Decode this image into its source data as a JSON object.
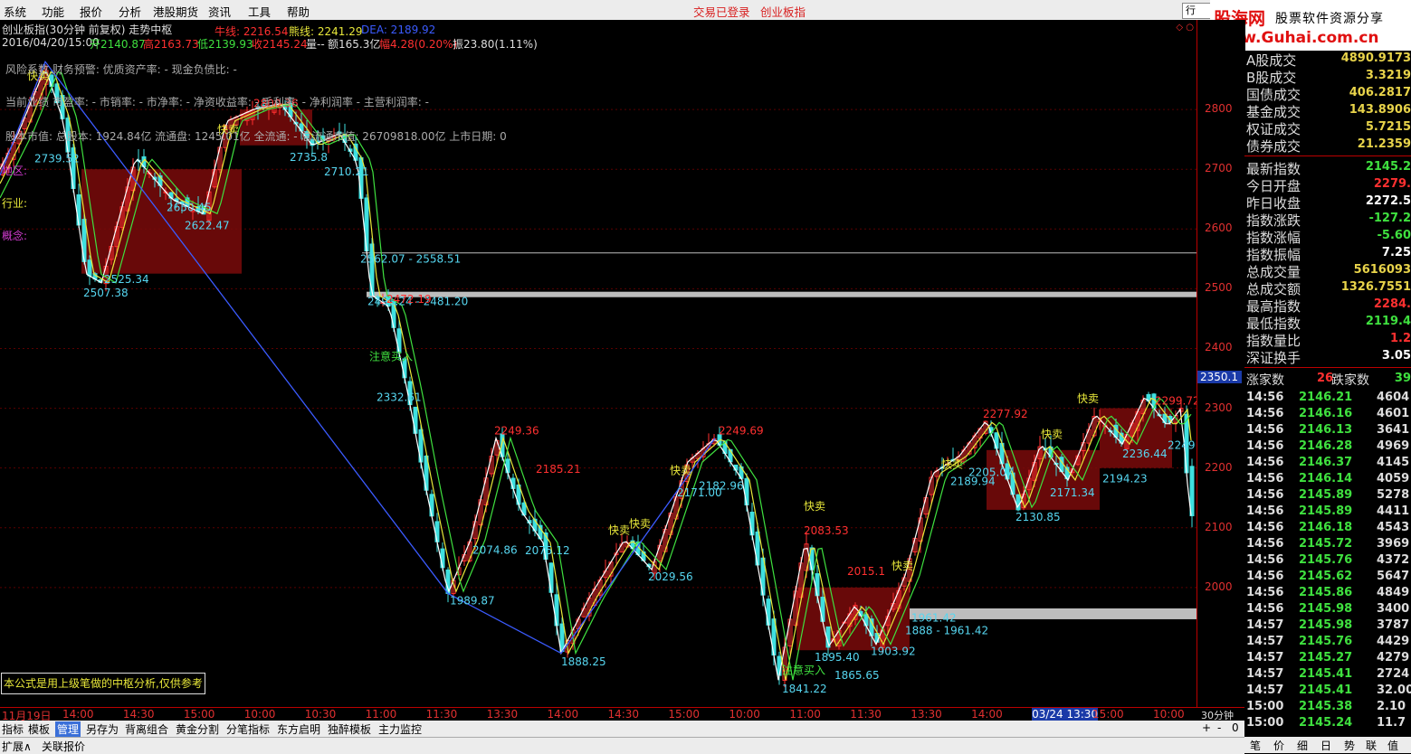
{
  "menu": {
    "items": [
      "系统",
      "功能",
      "报价",
      "分析",
      "港股期货",
      "资讯",
      "工具",
      "帮助"
    ],
    "center_links": [
      "交易已登录",
      "创业板指"
    ],
    "row_selector": "行"
  },
  "logo": {
    "name": "股海网",
    "slogan": "股票软件资源分享",
    "url": "www.Guhai.com.cn"
  },
  "chart_header": {
    "title": "创业板指(30分钟 前复权) 走势中枢",
    "niu_label": "牛线: 2216.54",
    "xiong_label": "熊线: 2241.29",
    "dea_label": "DEA: 2189.92",
    "bar_info": {
      "date": "2016/04/20/15:00",
      "open": "开2140.87",
      "high": "高2163.73",
      "low": "低2139.93",
      "close": "收2145.24",
      "vol": "量--",
      "amount": "额165.3亿",
      "change": "幅4.28(0.20%)",
      "amplitude": "振23.80(1.11%)"
    },
    "risk_line": "风险系数 财务预警: 优质资产率: - 现金负债比: -",
    "perf_line": "当前业绩 市盈率: - 市销率: - 市净率: - 净资收益率: - 毛利率: - 净利润率 - 主营利润率: -",
    "shares_line": "股本市值: 总股本: 1924.84亿 流通盘: 1245.01亿 全流通: - 总流通市值: 26709818.00亿 上市日期: 0",
    "region_label": "地区:",
    "industry_label": "行业:",
    "concept_label": "概念:"
  },
  "footnote": "本公式是用上级笔做的中枢分析,仅供参考",
  "chart_data": {
    "type": "candlestick",
    "title": "创业板指(30分钟 前复权) 走势中枢",
    "ylim": [
      1800,
      2950
    ],
    "y_ticks": [
      2000,
      2100,
      2200,
      2300,
      2400,
      2500,
      2600,
      2700,
      2800
    ],
    "current_price_label": "2350.1",
    "x_ticks": [
      "11月19日",
      "14:00",
      "14:30",
      "15:00",
      "10:00",
      "10:30",
      "11:00",
      "11:30",
      "13:30",
      "14:00",
      "14:30",
      "15:00",
      "10:00",
      "11:00",
      "11:30",
      "13:30",
      "14:00",
      "03/24 13:30",
      "15:00",
      "10:00"
    ],
    "period_label": "30分钟",
    "price_annotations": [
      "2739.52",
      "2525.34",
      "2507.38",
      "2650.45",
      "2622.47",
      "2735.8",
      "2710.21",
      "2800.36",
      "2562.07 - 2558.51",
      "2491.24 - 2481.20",
      "2472.19",
      "2332.61",
      "2249.36",
      "2185.21",
      "2074.86",
      "2075.12",
      "1989.87",
      "1888.25",
      "2029.56",
      "2249.69",
      "2171.00",
      "2182.96",
      "2083.53",
      "2015.1",
      "1895.40",
      "1865.65",
      "1903.92",
      "1841.22",
      "1961.42",
      "1888 - 1961.42",
      "2277.92",
      "2205.07",
      "2189.94",
      "2130.85",
      "2171.34",
      "2194.23",
      "2236.44",
      "2299.72",
      "2249"
    ],
    "signals": [
      "快卖",
      "注意买入"
    ],
    "pivot_zones": [
      {
        "from": "2525.34",
        "to": "2700"
      },
      {
        "from": "2740",
        "to": "2800"
      },
      {
        "from": "2130",
        "to": "2230"
      },
      {
        "from": "1895",
        "to": "2000"
      },
      {
        "from": "2200",
        "to": "2300"
      }
    ],
    "series": [
      {
        "name": "牛线"
      },
      {
        "name": "熊线"
      },
      {
        "name": "DEA"
      }
    ]
  },
  "tabs": [
    "指标",
    "模板",
    "管理",
    "另存为",
    "背离组合",
    "黄金分割",
    "分笔指标",
    "东方启明",
    "独醉模板",
    "主力监控"
  ],
  "status": [
    "扩展∧",
    "关联报价"
  ],
  "nav_controls": [
    "+",
    "-",
    "0"
  ],
  "market_stats": [
    {
      "label": "A股成交",
      "value": "4890.9173",
      "color": "#e8d34a"
    },
    {
      "label": "B股成交",
      "value": "3.3219",
      "color": "#e8d34a"
    },
    {
      "label": "国债成交",
      "value": "406.2817",
      "color": "#e8d34a"
    },
    {
      "label": "基金成交",
      "value": "143.8906",
      "color": "#e8d34a"
    },
    {
      "label": "权证成交",
      "value": "5.7215",
      "color": "#e8d34a"
    },
    {
      "label": "债券成交",
      "value": "21.2359",
      "color": "#e8d34a"
    }
  ],
  "index_stats": [
    {
      "label": "最新指数",
      "value": "2145.2",
      "color": "#3fe03f"
    },
    {
      "label": "今日开盘",
      "value": "2279.",
      "color": "#ff3030"
    },
    {
      "label": "昨日收盘",
      "value": "2272.5",
      "color": "#ffffff"
    },
    {
      "label": "指数涨跌",
      "value": "-127.2",
      "color": "#3fe03f"
    },
    {
      "label": "指数涨幅",
      "value": "-5.60",
      "color": "#3fe03f"
    },
    {
      "label": "指数振幅",
      "value": "7.25",
      "color": "#ffffff"
    },
    {
      "label": "总成交量",
      "value": "5616093",
      "color": "#e8d34a"
    },
    {
      "label": "总成交额",
      "value": "1326.7551",
      "color": "#e8d34a"
    },
    {
      "label": "最高指数",
      "value": "2284.",
      "color": "#ff3030"
    },
    {
      "label": "最低指数",
      "value": "2119.4",
      "color": "#3fe03f"
    },
    {
      "label": "指数量比",
      "value": "1.2",
      "color": "#ff3030"
    },
    {
      "label": "深证换手",
      "value": "3.05",
      "color": "#ffffff"
    }
  ],
  "breadth": {
    "up_label": "涨家数",
    "up_value": "26",
    "down_label": "跌家数",
    "down_value": "39"
  },
  "ticks": [
    {
      "time": "14:56",
      "price": "2146.21",
      "vol": "4604"
    },
    {
      "time": "14:56",
      "price": "2146.16",
      "vol": "4601"
    },
    {
      "time": "14:56",
      "price": "2146.13",
      "vol": "3641"
    },
    {
      "time": "14:56",
      "price": "2146.28",
      "vol": "4969"
    },
    {
      "time": "14:56",
      "price": "2146.37",
      "vol": "4145"
    },
    {
      "time": "14:56",
      "price": "2146.14",
      "vol": "4059"
    },
    {
      "time": "14:56",
      "price": "2145.89",
      "vol": "5278"
    },
    {
      "time": "14:56",
      "price": "2145.89",
      "vol": "4411"
    },
    {
      "time": "14:56",
      "price": "2146.18",
      "vol": "4543"
    },
    {
      "time": "14:56",
      "price": "2145.72",
      "vol": "3969"
    },
    {
      "time": "14:56",
      "price": "2145.76",
      "vol": "4372"
    },
    {
      "time": "14:56",
      "price": "2145.62",
      "vol": "5647"
    },
    {
      "time": "14:56",
      "price": "2145.86",
      "vol": "4849"
    },
    {
      "time": "14:56",
      "price": "2145.98",
      "vol": "3400"
    },
    {
      "time": "14:57",
      "price": "2145.98",
      "vol": "3787"
    },
    {
      "time": "14:57",
      "price": "2145.76",
      "vol": "4429"
    },
    {
      "time": "14:57",
      "price": "2145.27",
      "vol": "4279"
    },
    {
      "time": "14:57",
      "price": "2145.41",
      "vol": "2724"
    },
    {
      "time": "14:57",
      "price": "2145.41",
      "vol": "32.00"
    },
    {
      "time": "15:00",
      "price": "2145.38",
      "vol": "2.10"
    },
    {
      "time": "15:00",
      "price": "2145.24",
      "vol": "11.7"
    }
  ],
  "bottom_tabs": [
    "笔",
    "价",
    "细",
    "日",
    "势",
    "联",
    "值"
  ],
  "colors": {
    "up": "#ff3030",
    "down": "#3fe0e0",
    "zone": "#7a0a0a",
    "ma1": "#ffffff",
    "ma2": "#e8e83a",
    "ma3": "#3fe03f",
    "pen": "#3b5bff"
  }
}
